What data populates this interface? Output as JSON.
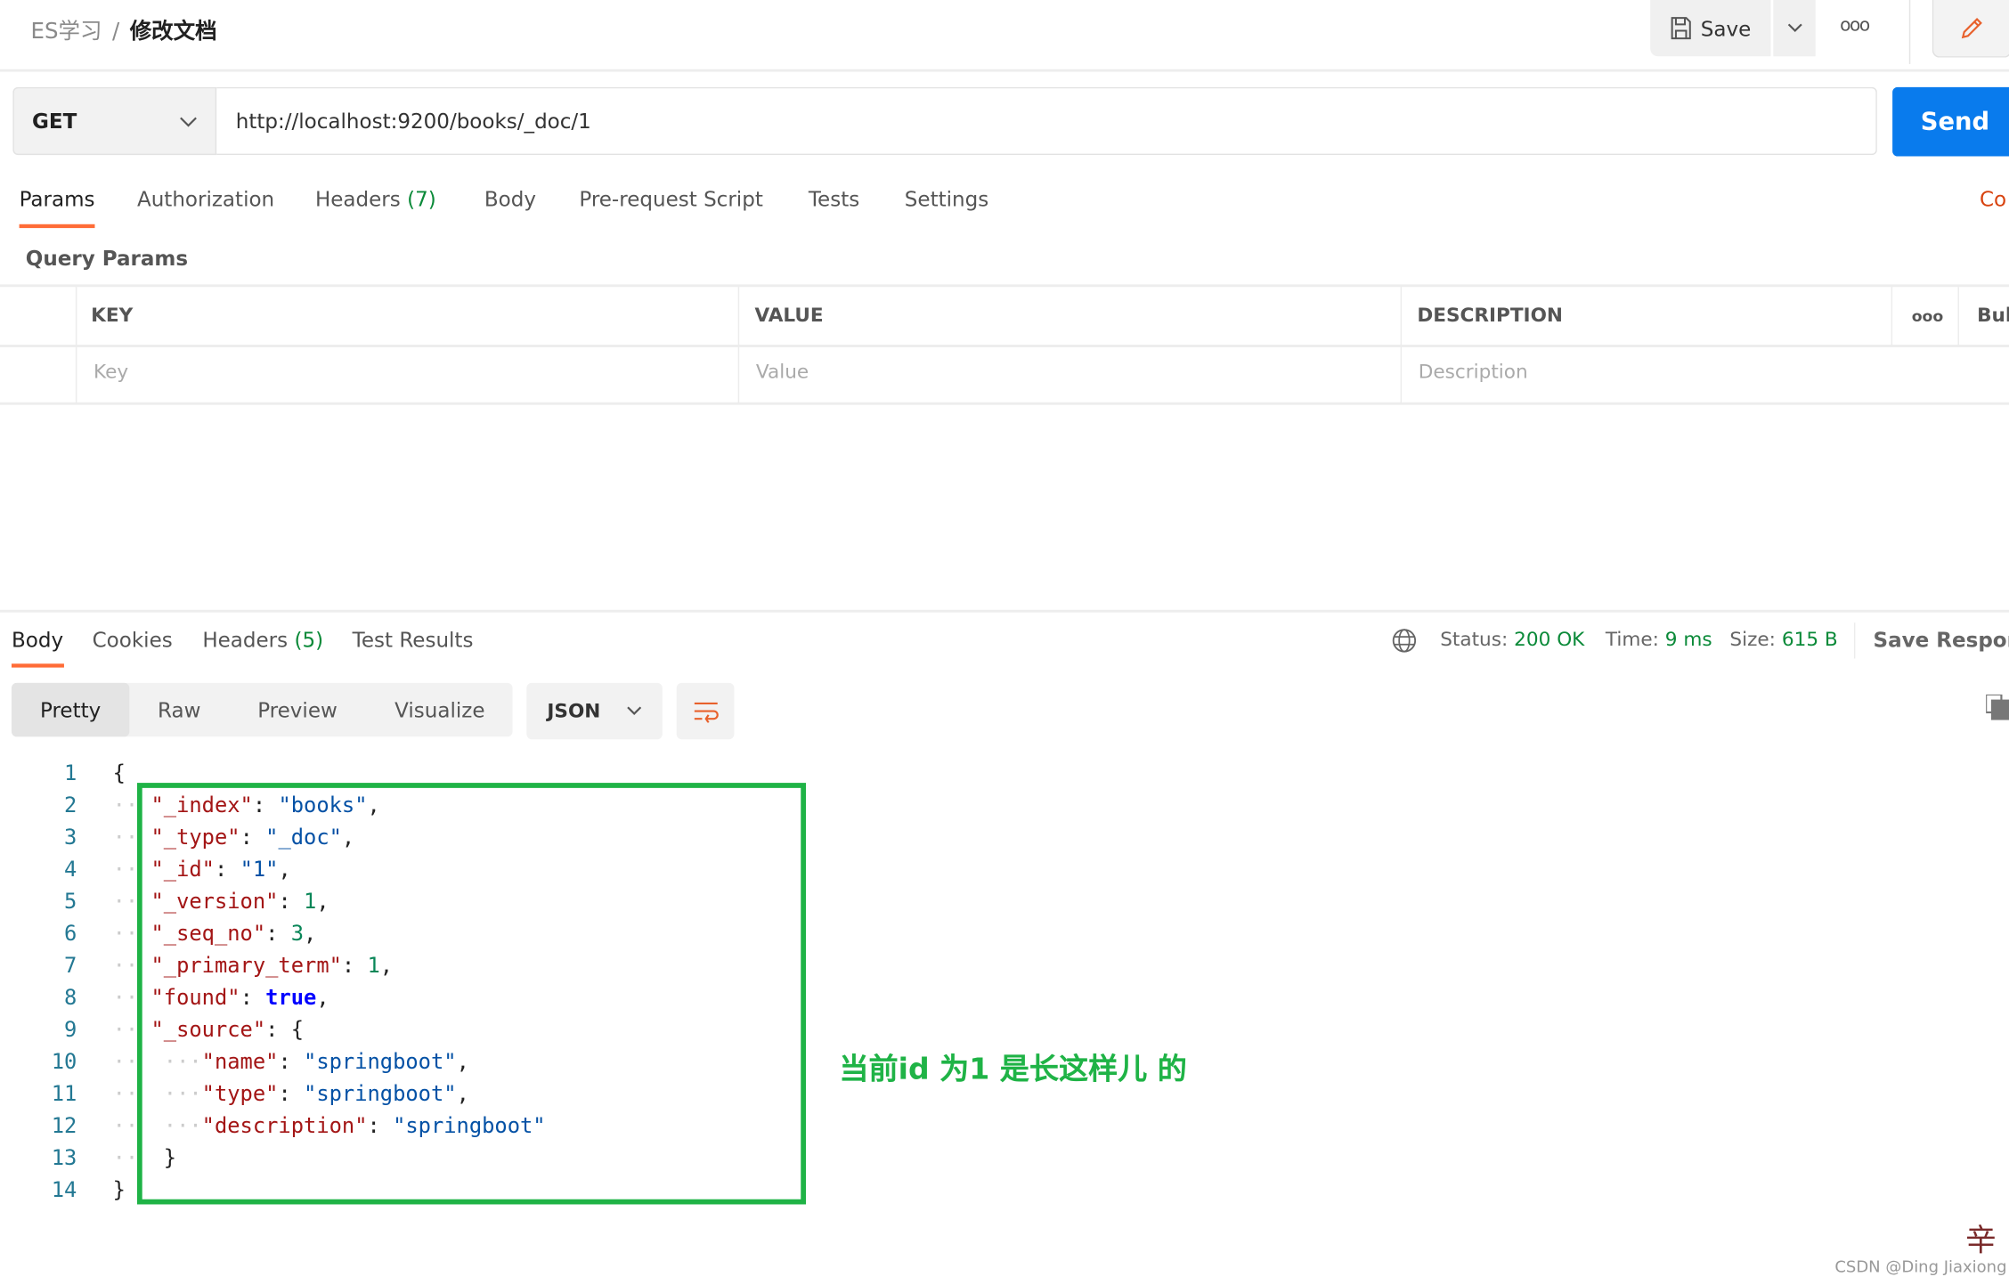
{
  "breadcrumb": {
    "parent": "ES学习",
    "separator": "/",
    "current": "修改文档"
  },
  "toolbar": {
    "save_label": "Save",
    "more_icon": "ellipsis-icon",
    "edit_icon": "pencil-icon"
  },
  "request": {
    "method": "GET",
    "url": "http://localhost:9200/books/_doc/1",
    "send_label": "Send"
  },
  "request_tabs": [
    {
      "label": "Params",
      "active": true
    },
    {
      "label": "Authorization"
    },
    {
      "label": "Headers",
      "count": "(7)"
    },
    {
      "label": "Body"
    },
    {
      "label": "Pre-request Script"
    },
    {
      "label": "Tests"
    },
    {
      "label": "Settings"
    }
  ],
  "cookies_link": "Co",
  "query_params": {
    "title": "Query Params",
    "headers": [
      "KEY",
      "VALUE",
      "DESCRIPTION"
    ],
    "bulk_label": "Bul",
    "placeholders": [
      "Key",
      "Value",
      "Description"
    ]
  },
  "response_tabs": [
    {
      "label": "Body",
      "active": true
    },
    {
      "label": "Cookies"
    },
    {
      "label": "Headers",
      "count": "(5)"
    },
    {
      "label": "Test Results"
    }
  ],
  "response_meta": {
    "status_label": "Status:",
    "status": "200 OK",
    "time_label": "Time:",
    "time": "9 ms",
    "size_label": "Size:",
    "size": "615 B",
    "save_response": "Save Respons"
  },
  "view_modes": [
    "Pretty",
    "Raw",
    "Preview",
    "Visualize"
  ],
  "format": "JSON",
  "colors": {
    "accent": "#ff6c37",
    "send": "#097bed",
    "success": "#0b8a39",
    "annotation": "#1fb346"
  },
  "code_lines": [
    "1",
    "2",
    "3",
    "4",
    "5",
    "6",
    "7",
    "8",
    "9",
    "10",
    "11",
    "12",
    "13",
    "14"
  ],
  "code": {
    "open": "{",
    "close": "}",
    "l2": [
      "\"_index\"",
      "\"books\""
    ],
    "l3": [
      "\"_type\"",
      "\"_doc\""
    ],
    "l4": [
      "\"_id\"",
      "\"1\""
    ],
    "l5": [
      "\"_version\"",
      "1"
    ],
    "l6": [
      "\"_seq_no\"",
      "3"
    ],
    "l7": [
      "\"_primary_term\"",
      "1"
    ],
    "l8": [
      "\"found\"",
      "true"
    ],
    "l9": [
      "\"_source\"",
      "{"
    ],
    "l10": [
      "\"name\"",
      "\"springboot\""
    ],
    "l11": [
      "\"type\"",
      "\"springboot\""
    ],
    "l12": [
      "\"description\"",
      "\"springboot\""
    ],
    "l13": "}"
  },
  "annotation": "当前id 为1 是长这样儿 的",
  "watermark": "CSDN @Ding Jiaxiong",
  "sticker_text": "辛"
}
